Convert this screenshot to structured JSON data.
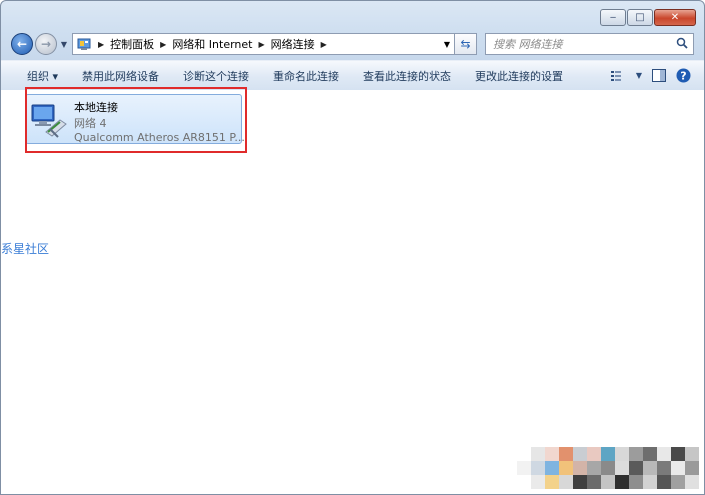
{
  "window": {
    "minimize_icon": "minimize-icon",
    "maximize_icon": "maximize-icon",
    "close_icon": "close-icon"
  },
  "address_bar": {
    "breadcrumbs": [
      "控制面板",
      "网络和 Internet",
      "网络连接"
    ]
  },
  "search": {
    "placeholder": "搜索 网络连接"
  },
  "toolbar": {
    "organize": "组织 ▾",
    "disable_device": "禁用此网络设备",
    "diagnose": "诊断这个连接",
    "rename": "重命名此连接",
    "view_status": "查看此连接的状态",
    "change_settings": "更改此连接的设置"
  },
  "connection": {
    "name": "本地连接",
    "network": "网络  4",
    "device": "Qualcomm Atheros AR8151 P..."
  },
  "watermark": {
    "text": "系星社区"
  },
  "colors": {
    "accent": "#1f5cb3",
    "highlight_border": "#e02b2b",
    "selection_bg": "#cde3fa"
  }
}
